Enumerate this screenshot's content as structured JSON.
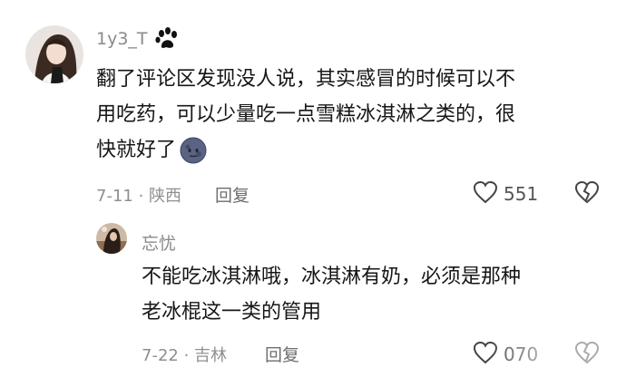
{
  "comment": {
    "username": "1y3_T",
    "text_line1": "翻了评论区发现没人说，其实感冒的时候可以不",
    "text_line2": "用吃药，可以少量吃一点雪糕冰淇淋之类的，很",
    "text_line3": "快就好了",
    "date": "7-11",
    "location": "陕西",
    "reply_label": "回复",
    "likes": "551",
    "icons": [
      "paw-icon",
      "moon-face-emoji",
      "heart-outline-icon",
      "dislike-broken-heart-icon"
    ]
  },
  "reply": {
    "username": "忘忧",
    "text_line1": "不能吃冰淇淋哦，冰淇淋有奶，必须是那种",
    "text_line2": "老冰棍这一类的管用",
    "date": "7-22",
    "location": "吉林",
    "reply_label": "回复",
    "likes": "070",
    "icons": [
      "heart-outline-icon",
      "dislike-broken-heart-icon"
    ]
  }
}
